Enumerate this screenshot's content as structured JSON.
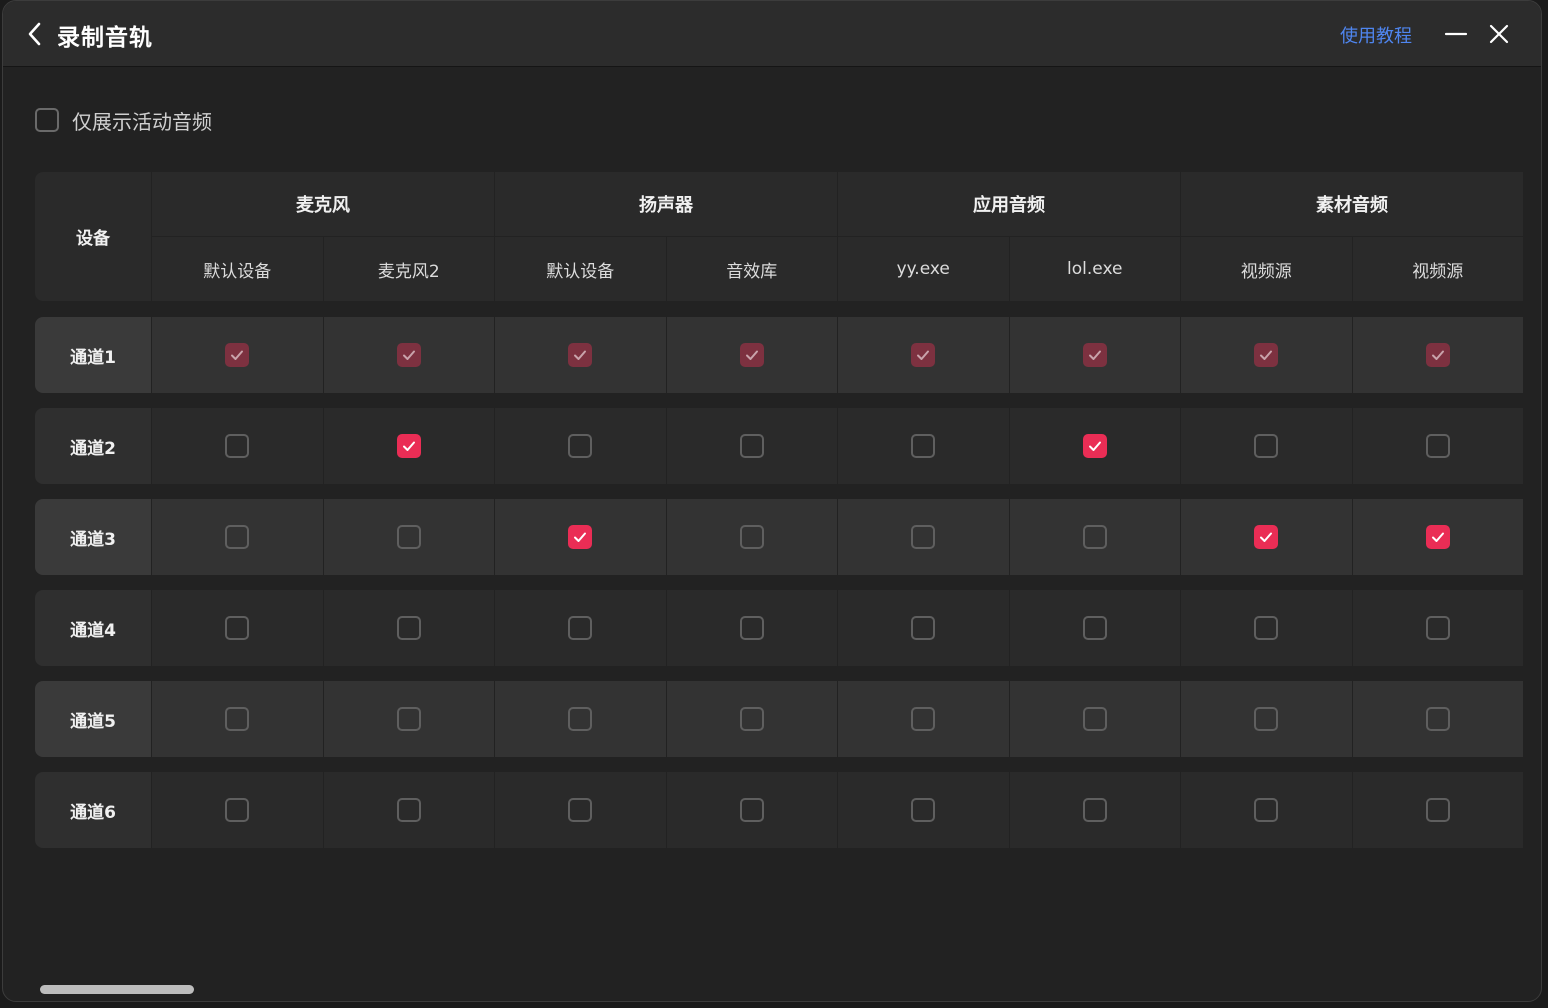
{
  "window": {
    "title": "录制音轨",
    "help_link": "使用教程"
  },
  "filter": {
    "label": "仅展示活动音频",
    "checked": false
  },
  "table": {
    "corner_label": "设备",
    "groups": [
      {
        "label": "麦克风",
        "columns": [
          "默认设备",
          "麦克风2"
        ]
      },
      {
        "label": "扬声器",
        "columns": [
          "默认设备",
          "音效库"
        ]
      },
      {
        "label": "应用音频",
        "columns": [
          "yy.exe",
          "lol.exe"
        ]
      },
      {
        "label": "素材音频",
        "columns": [
          "视频源",
          "视频源"
        ]
      }
    ],
    "rows": [
      {
        "label": "通道1",
        "state": [
          "dim",
          "dim",
          "dim",
          "dim",
          "dim",
          "dim",
          "dim",
          "dim"
        ]
      },
      {
        "label": "通道2",
        "state": [
          "off",
          "on",
          "off",
          "off",
          "off",
          "on",
          "off",
          "off"
        ]
      },
      {
        "label": "通道3",
        "state": [
          "off",
          "off",
          "on",
          "off",
          "off",
          "off",
          "on",
          "on"
        ]
      },
      {
        "label": "通道4",
        "state": [
          "off",
          "off",
          "off",
          "off",
          "off",
          "off",
          "off",
          "off"
        ]
      },
      {
        "label": "通道5",
        "state": [
          "off",
          "off",
          "off",
          "off",
          "off",
          "off",
          "off",
          "off"
        ]
      },
      {
        "label": "通道6",
        "state": [
          "off",
          "off",
          "off",
          "off",
          "off",
          "off",
          "off",
          "off"
        ]
      }
    ]
  },
  "colors": {
    "accent": "#ea2d55",
    "accent_dim": "#7d3140",
    "link": "#4f86f0"
  },
  "icons": {
    "back": "chevron-left-icon",
    "minimize": "minimize-icon",
    "close": "close-icon",
    "check": "check-icon"
  }
}
